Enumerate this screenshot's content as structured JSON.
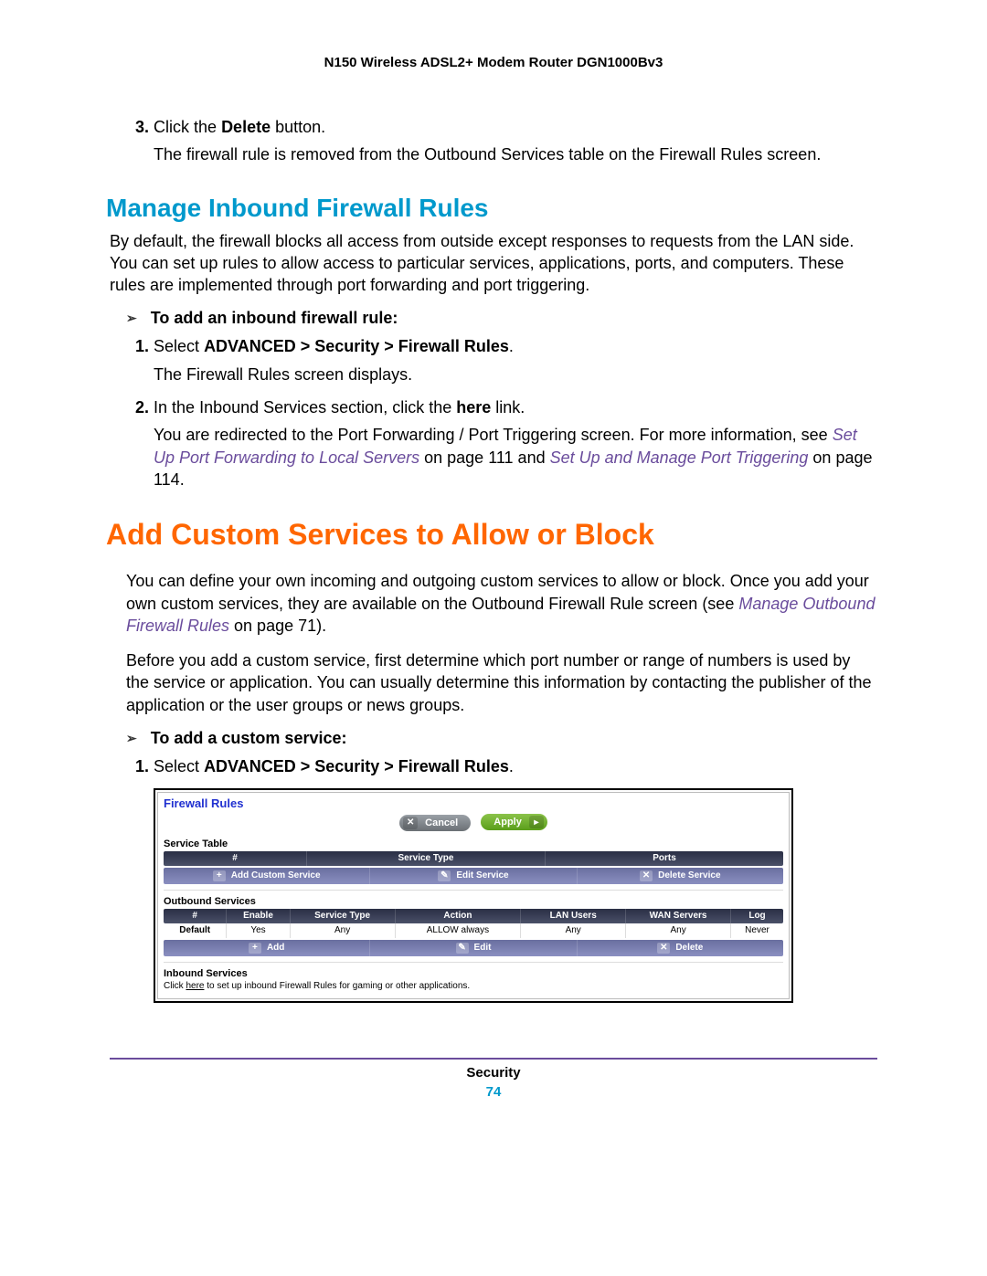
{
  "header": "N150 Wireless ADSL2+ Modem Router DGN1000Bv3",
  "step3": {
    "num": "3.",
    "line": "Click the ",
    "bold": "Delete",
    "tail": " button.",
    "body": "The firewall rule is removed from the Outbound Services table on the Firewall Rules screen."
  },
  "h2": "Manage Inbound Firewall Rules",
  "intro1": "By default, the firewall blocks all access from outside except responses to requests from the LAN side. You can set up rules to allow access to particular services, applications, ports, and computers. These rules are implemented through port forwarding and port triggering.",
  "sub1": "To add an inbound firewall rule:",
  "s1": {
    "num": "1.",
    "pre": "Select ",
    "bold": "ADVANCED > Security > Firewall Rules",
    "post": ".",
    "body": "The Firewall Rules screen displays."
  },
  "s2": {
    "num": "2.",
    "pre": "In the Inbound Services section, click the ",
    "bold": "here",
    "post": " link.",
    "body_a": "You are redirected to the Port Forwarding / Port Triggering screen. For more information, see ",
    "xref1": "Set Up Port Forwarding to Local Servers",
    "mid": " on page 111 and ",
    "xref2": "Set Up and Manage Port Triggering",
    "tail": " on page 114."
  },
  "h1": "Add Custom Services to Allow or Block",
  "p1_a": "You can define your own incoming and outgoing custom services to allow or block. Once you add your own custom services, they are available on the Outbound Firewall Rule screen (see ",
  "p1_xref": "Manage Outbound Firewall Rules",
  "p1_b": " on page 71).",
  "p2": "Before you add a custom service, first determine which port number or range of numbers is used by the service or application. You can usually determine this information by contacting the publisher of the application or the user groups or news groups.",
  "sub2": "To add a custom service:",
  "cs1": {
    "num": "1.",
    "pre": "Select ",
    "bold": "ADVANCED > Security > Firewall Rules",
    "post": "."
  },
  "shot": {
    "title": "Firewall Rules",
    "cancel": "Cancel",
    "apply": "Apply",
    "service_table": "Service Table",
    "service_cols": [
      "#",
      "Service Type",
      "Ports"
    ],
    "btn_add_cs": "Add Custom Service",
    "btn_edit_s": "Edit Service",
    "btn_del_s": "Delete Service",
    "outbound": "Outbound Services",
    "out_cols": [
      "#",
      "Enable",
      "Service Type",
      "Action",
      "LAN Users",
      "WAN Servers",
      "Log"
    ],
    "out_row": [
      "Default",
      "Yes",
      "Any",
      "ALLOW always",
      "Any",
      "Any",
      "Never"
    ],
    "b_add": "Add",
    "b_edit": "Edit",
    "b_del": "Delete",
    "inbound": "Inbound Services",
    "inbound_note_a": "Click ",
    "inbound_link": "here",
    "inbound_note_b": " to set up inbound Firewall Rules for gaming or other applications."
  },
  "footer_sec": "Security",
  "footer_pg": "74"
}
